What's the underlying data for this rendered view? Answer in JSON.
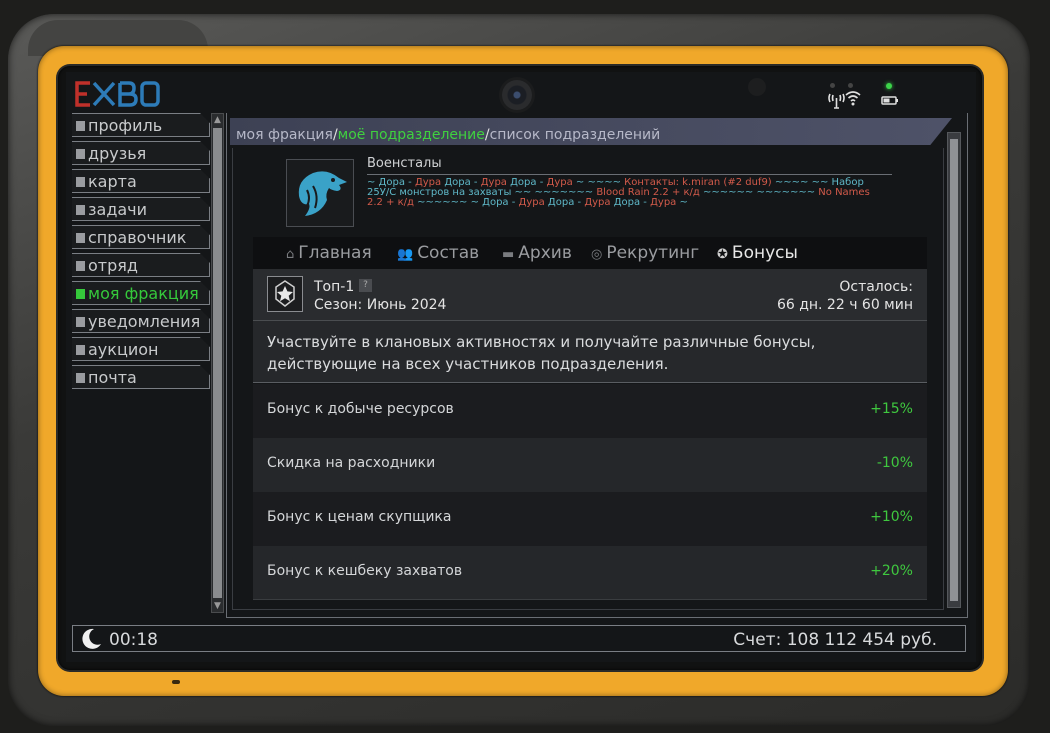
{
  "device": {
    "logo_text": "EXBO"
  },
  "sidebar": {
    "items": [
      {
        "label": "профиль",
        "active": false
      },
      {
        "label": "друзья",
        "active": false
      },
      {
        "label": "карта",
        "active": false
      },
      {
        "label": "задачи",
        "active": false
      },
      {
        "label": "справочник",
        "active": false
      },
      {
        "label": "отряд",
        "active": false
      },
      {
        "label": "моя фракция",
        "active": true
      },
      {
        "label": "уведомления",
        "active": false
      },
      {
        "label": "аукцион",
        "active": false
      },
      {
        "label": "почта",
        "active": false
      }
    ]
  },
  "breadcrumb": {
    "items": [
      "моя фракция",
      "моё подразделение",
      "список подразделений"
    ],
    "separator": "/"
  },
  "clan": {
    "name": "Военсталы",
    "emblem_icon": "eagle-icon",
    "description_parts": [
      {
        "text": "~ Дора - ",
        "c": "t"
      },
      {
        "text": "Дура",
        "c": "r"
      },
      {
        "text": " Дора - ",
        "c": "t"
      },
      {
        "text": "Дура",
        "c": "r"
      },
      {
        "text": " Дора - ",
        "c": "t"
      },
      {
        "text": "Дура",
        "c": "r"
      },
      {
        "text": " ~ ~~~~ ",
        "c": "t"
      },
      {
        "text": "Контакты: k.miran (#2 duf9)",
        "c": "r"
      },
      {
        "text": " ~~~~ ~~ Набор 25У/С монстров на захваты ~~ ~~~~~~~ ",
        "c": "t"
      },
      {
        "text": "Blood Rain 2.2 + к/д",
        "c": "r"
      },
      {
        "text": " ~~~~~~ ~~~~~~~ ",
        "c": "t"
      },
      {
        "text": "No Names 2.2 + к/д",
        "c": "r"
      },
      {
        "text": " ~~~~~~ ~ Дора - ",
        "c": "t"
      },
      {
        "text": "Дура",
        "c": "r"
      },
      {
        "text": " Дора - ",
        "c": "t"
      },
      {
        "text": "Дура",
        "c": "r"
      },
      {
        "text": " Дора - ",
        "c": "t"
      },
      {
        "text": "Дура",
        "c": "r"
      },
      {
        "text": " ~",
        "c": "t"
      }
    ]
  },
  "tabs": [
    {
      "label": "Главная",
      "icon": "home-icon",
      "active": false
    },
    {
      "label": "Состав",
      "icon": "members-icon",
      "active": false
    },
    {
      "label": "Архив",
      "icon": "archive-icon",
      "active": false
    },
    {
      "label": "Рекрутинг",
      "icon": "recruit-icon",
      "active": false
    },
    {
      "label": "Бонусы",
      "icon": "pentagon-star-icon",
      "active": true
    }
  ],
  "season": {
    "rank": "Топ-1",
    "help_label": "?",
    "season_label": "Сезон: Июнь 2024",
    "remaining_label": "Осталось:",
    "remaining_value": "66 дн. 22 ч 60 мин"
  },
  "description": "Участвуйте в клановых активностях и получайте различные бонусы, действующие на всех участников подразделения.",
  "bonuses": [
    {
      "label": "Бонус к добыче ресурсов",
      "value": "+15%"
    },
    {
      "label": "Скидка на расходники",
      "value": "-10%"
    },
    {
      "label": "Бонус к ценам скупщика",
      "value": "+10%"
    },
    {
      "label": "Бонус к кешбеку захватов",
      "value": "+20%"
    }
  ],
  "status": {
    "time_icon": "moon-icon",
    "time": "00:18",
    "balance": "Счет: 108 112 454 руб."
  },
  "colors": {
    "accent_green": "#35c93b",
    "frame_orange": "#f0a82a",
    "desc_teal": "#5fb8c8",
    "desc_red": "#d25a4a"
  }
}
